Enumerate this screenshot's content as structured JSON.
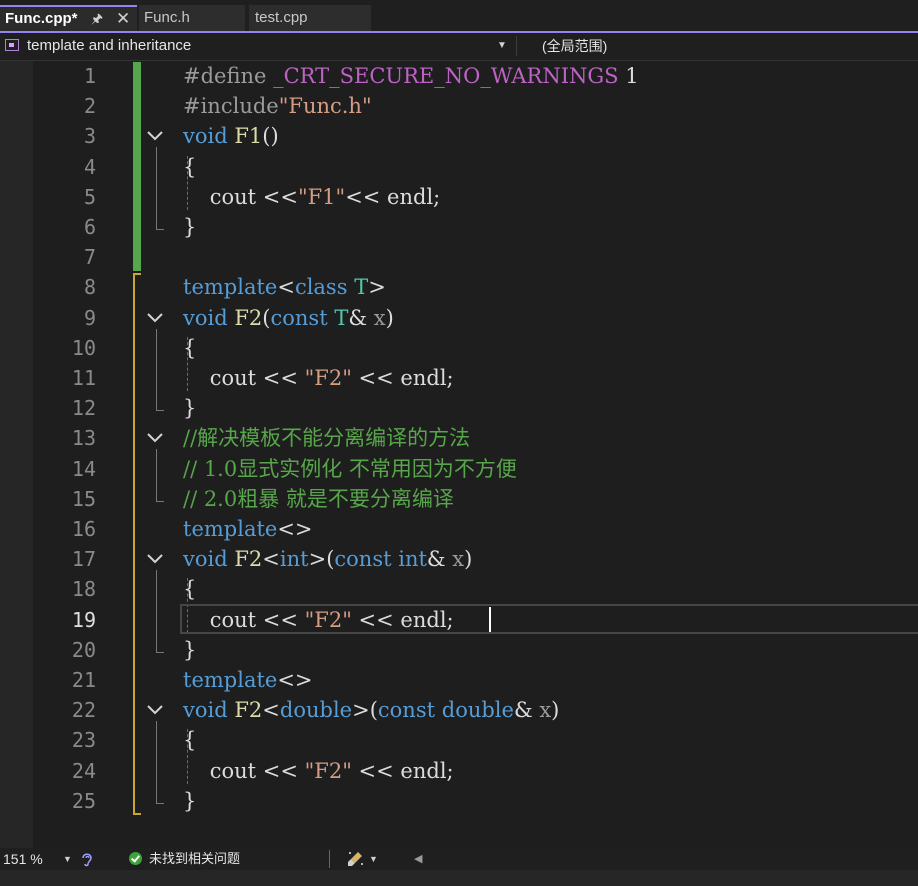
{
  "tabs": [
    {
      "label": "Func.cpp*",
      "active": true
    },
    {
      "label": "Func.h",
      "active": false
    },
    {
      "label": "test.cpp",
      "active": false
    }
  ],
  "tab_pin_glyph": "🖈",
  "tab_close_glyph": "✕",
  "nav": {
    "scope_left": "template and inheritance",
    "scope_right": "(全局范围)"
  },
  "editor": {
    "current_line": 19,
    "line_numbers": [
      "1",
      "2",
      "3",
      "4",
      "5",
      "6",
      "7",
      "8",
      "9",
      "10",
      "11",
      "12",
      "13",
      "14",
      "15",
      "16",
      "17",
      "18",
      "19",
      "20",
      "21",
      "22",
      "23",
      "24",
      "25"
    ],
    "lines": [
      [
        {
          "t": "#define ",
          "c": "pp"
        },
        {
          "t": "_CRT_SECURE_NO_WARNINGS",
          "c": "mc"
        },
        {
          "t": " 1",
          "c": "id"
        }
      ],
      [
        {
          "t": "#include",
          "c": "pp"
        },
        {
          "t": "\"Func.h\"",
          "c": "str"
        }
      ],
      [
        {
          "t": "void",
          "c": "kw"
        },
        {
          "t": " ",
          "c": "id"
        },
        {
          "t": "F1",
          "c": "fn"
        },
        {
          "t": "()",
          "c": "id"
        }
      ],
      [
        {
          "t": "{",
          "c": "id"
        }
      ],
      [
        {
          "t": "    cout <<",
          "c": "id"
        },
        {
          "t": "\"F1\"",
          "c": "str"
        },
        {
          "t": "<< endl;",
          "c": "id"
        }
      ],
      [
        {
          "t": "}",
          "c": "id"
        }
      ],
      [],
      [
        {
          "t": "template",
          "c": "kw"
        },
        {
          "t": "<",
          "c": "id"
        },
        {
          "t": "class",
          "c": "kw"
        },
        {
          "t": " ",
          "c": "id"
        },
        {
          "t": "T",
          "c": "ty"
        },
        {
          "t": ">",
          "c": "id"
        }
      ],
      [
        {
          "t": "void",
          "c": "kw"
        },
        {
          "t": " ",
          "c": "id"
        },
        {
          "t": "F2",
          "c": "fn"
        },
        {
          "t": "(",
          "c": "id"
        },
        {
          "t": "const",
          "c": "kw"
        },
        {
          "t": " ",
          "c": "id"
        },
        {
          "t": "T",
          "c": "ty"
        },
        {
          "t": "& ",
          "c": "id"
        },
        {
          "t": "x",
          "c": "pa"
        },
        {
          "t": ")",
          "c": "id"
        }
      ],
      [
        {
          "t": "{",
          "c": "id"
        }
      ],
      [
        {
          "t": "    cout << ",
          "c": "id"
        },
        {
          "t": "\"F2\"",
          "c": "str"
        },
        {
          "t": " << endl;",
          "c": "id"
        }
      ],
      [
        {
          "t": "}",
          "c": "id"
        }
      ],
      [
        {
          "t": "//解决模板不能分离编译的方法",
          "c": "cm"
        }
      ],
      [
        {
          "t": "// 1.0显式实例化 不常用因为不方便",
          "c": "cm"
        }
      ],
      [
        {
          "t": "// 2.0粗暴 就是不要分离编译",
          "c": "cm"
        }
      ],
      [
        {
          "t": "template",
          "c": "kw"
        },
        {
          "t": "<>",
          "c": "id"
        }
      ],
      [
        {
          "t": "void",
          "c": "kw"
        },
        {
          "t": " ",
          "c": "id"
        },
        {
          "t": "F2",
          "c": "fn"
        },
        {
          "t": "<",
          "c": "id"
        },
        {
          "t": "int",
          "c": "kw"
        },
        {
          "t": ">(",
          "c": "id"
        },
        {
          "t": "const",
          "c": "kw"
        },
        {
          "t": " ",
          "c": "id"
        },
        {
          "t": "int",
          "c": "kw"
        },
        {
          "t": "& ",
          "c": "id"
        },
        {
          "t": "x",
          "c": "pa"
        },
        {
          "t": ")",
          "c": "id"
        }
      ],
      [
        {
          "t": "{",
          "c": "id"
        }
      ],
      [
        {
          "t": "    cout << ",
          "c": "id"
        },
        {
          "t": "\"F2\"",
          "c": "str"
        },
        {
          "t": " << endl;",
          "c": "id"
        }
      ],
      [
        {
          "t": "}",
          "c": "id"
        }
      ],
      [
        {
          "t": "template",
          "c": "kw"
        },
        {
          "t": "<>",
          "c": "id"
        }
      ],
      [
        {
          "t": "void",
          "c": "kw"
        },
        {
          "t": " ",
          "c": "id"
        },
        {
          "t": "F2",
          "c": "fn"
        },
        {
          "t": "<",
          "c": "id"
        },
        {
          "t": "double",
          "c": "kw"
        },
        {
          "t": ">(",
          "c": "id"
        },
        {
          "t": "const",
          "c": "kw"
        },
        {
          "t": " ",
          "c": "id"
        },
        {
          "t": "double",
          "c": "kw"
        },
        {
          "t": "& ",
          "c": "id"
        },
        {
          "t": "x",
          "c": "pa"
        },
        {
          "t": ")",
          "c": "id"
        }
      ],
      [
        {
          "t": "{",
          "c": "id"
        }
      ],
      [
        {
          "t": "    cout << ",
          "c": "id"
        },
        {
          "t": "\"F2\"",
          "c": "str"
        },
        {
          "t": " << endl;",
          "c": "id"
        }
      ],
      [
        {
          "t": "}",
          "c": "id"
        }
      ]
    ],
    "fold_lines": [
      3,
      9,
      13,
      17,
      22
    ],
    "change_saved_lines": [
      1,
      7
    ],
    "change_unsaved_lines": [
      8,
      25
    ]
  },
  "status": {
    "zoom": "151 %",
    "issues_text": "未找到相关问题"
  },
  "colors": {
    "keyword": "#569cd6",
    "function": "#dcdcaa",
    "string": "#d69d85",
    "comment": "#57a64a",
    "type": "#4ec9b0",
    "macro": "#bd63c5",
    "accent": "#9184ee",
    "saved_change": "#56a64b",
    "unsaved_change": "#c8a832"
  }
}
